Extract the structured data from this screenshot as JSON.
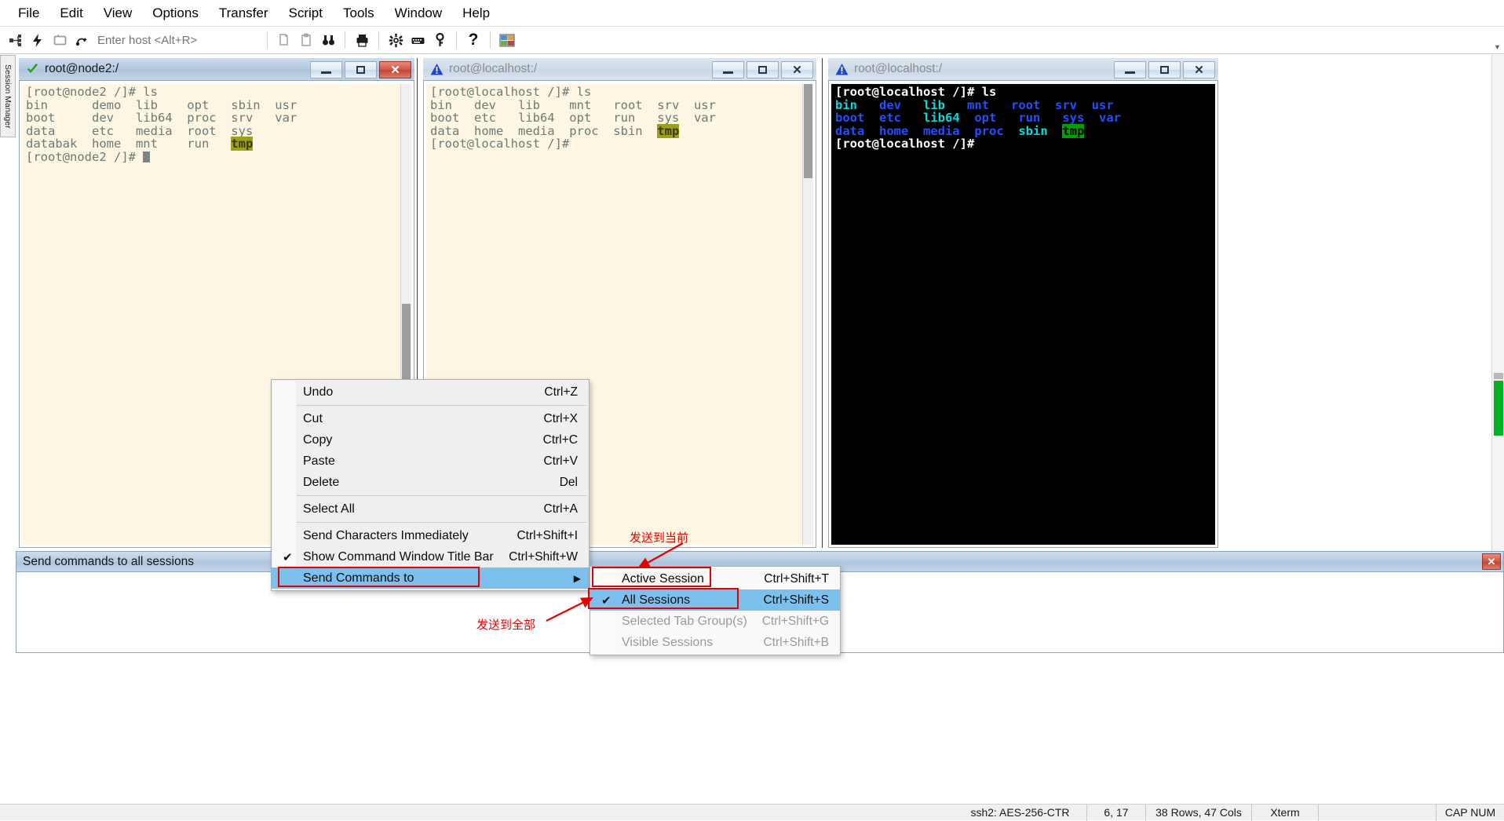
{
  "app": {
    "menubar": [
      "File",
      "Edit",
      "View",
      "Options",
      "Transfer",
      "Script",
      "Tools",
      "Window",
      "Help"
    ],
    "session_manager_label": "Session Manager"
  },
  "toolbar": {
    "host_placeholder": "Enter host <Alt+R>",
    "host_value": "",
    "buttons": [
      {
        "name": "connect-icon",
        "glyph": "⊷"
      },
      {
        "name": "quick-connect-icon",
        "glyph": "⚡"
      },
      {
        "name": "reconnect-icon",
        "glyph": "⟲"
      },
      {
        "name": "reconnect-all-icon",
        "glyph": "↝"
      },
      {
        "name": "copy-icon",
        "glyph": "❐"
      },
      {
        "name": "paste-icon",
        "glyph": "❏"
      },
      {
        "name": "find-icon",
        "glyph": "👓"
      },
      {
        "name": "print-icon",
        "glyph": "🖶"
      },
      {
        "name": "session-options-icon",
        "glyph": "✿"
      },
      {
        "name": "keymap-editor-icon",
        "glyph": "⌨"
      },
      {
        "name": "key-icon",
        "glyph": "⚷"
      },
      {
        "name": "help-icon",
        "glyph": "?"
      },
      {
        "name": "tile-windows-icon",
        "glyph": "▦"
      }
    ],
    "overflow_glyph": "▾"
  },
  "panes": [
    {
      "title": "root@node2:/",
      "status_icon": "check-icon",
      "active": true,
      "theme": "light",
      "lines": [
        [
          {
            "t": "[root@node2 /]# ls",
            "c": "fg"
          }
        ],
        [
          {
            "t": "bin      demo  lib    opt   sbin  usr",
            "c": "fg"
          }
        ],
        [
          {
            "t": "boot     dev   lib64  proc  srv   var",
            "c": "fg"
          }
        ],
        [
          {
            "t": "data     etc   media  root  sys",
            "c": "fg"
          }
        ],
        [
          {
            "t": "databak  home  mnt    run   ",
            "c": "fg"
          },
          {
            "t": "tmp",
            "c": "tmp"
          }
        ],
        [
          {
            "t": "[root@node2 /]# ",
            "c": "fg"
          }
        ]
      ]
    },
    {
      "title": "root@localhost:/",
      "status_icon": "warning-icon",
      "active": false,
      "theme": "light",
      "lines": [
        [
          {
            "t": "[root@localhost /]# ls",
            "c": "fg"
          }
        ],
        [
          {
            "t": "bin   dev   lib    mnt   root  srv  usr",
            "c": "fg"
          }
        ],
        [
          {
            "t": "boot  etc   lib64  opt   run   sys  var",
            "c": "fg"
          }
        ],
        [
          {
            "t": "data  home  media  proc  sbin  ",
            "c": "fg"
          },
          {
            "t": "tmp",
            "c": "tmp"
          }
        ],
        [
          {
            "t": "[root@localhost /]# ",
            "c": "fg"
          }
        ]
      ]
    },
    {
      "title": "root@localhost:/",
      "status_icon": "warning-icon",
      "active": false,
      "theme": "dark",
      "lines": [
        [
          {
            "t": "[root@localhost /]# ls",
            "c": "prompt"
          }
        ],
        [
          {
            "t": "bin   ",
            "c": "lnk"
          },
          {
            "t": "dev   ",
            "c": "dir"
          },
          {
            "t": "lib   ",
            "c": "lnk"
          },
          {
            "t": "mnt   ",
            "c": "dir"
          },
          {
            "t": "root  ",
            "c": "dir"
          },
          {
            "t": "srv  ",
            "c": "dir"
          },
          {
            "t": "usr",
            "c": "dir"
          }
        ],
        [
          {
            "t": "boot  ",
            "c": "dir"
          },
          {
            "t": "etc   ",
            "c": "dir"
          },
          {
            "t": "lib64  ",
            "c": "lnk"
          },
          {
            "t": "opt   ",
            "c": "dir"
          },
          {
            "t": "run   ",
            "c": "dir"
          },
          {
            "t": "sys  ",
            "c": "dir"
          },
          {
            "t": "var",
            "c": "dir"
          }
        ],
        [
          {
            "t": "data  ",
            "c": "dir"
          },
          {
            "t": "home  ",
            "c": "dir"
          },
          {
            "t": "media  ",
            "c": "dir"
          },
          {
            "t": "proc  ",
            "c": "dir"
          },
          {
            "t": "sbin  ",
            "c": "lnk"
          },
          {
            "t": "tmp",
            "c": "tmp"
          }
        ],
        [
          {
            "t": "[root@localhost /]# ",
            "c": "prompt"
          }
        ]
      ]
    }
  ],
  "window_controls": {
    "minimize": "–",
    "maximize": "❐",
    "close": "✕"
  },
  "command_window": {
    "title": "Send commands to all sessions",
    "close_label": "✕",
    "content": ""
  },
  "context_menu": {
    "items": [
      {
        "label": "Undo",
        "accel": "Ctrl+Z",
        "checked": false,
        "disabled": false,
        "submenu": false
      },
      {
        "sep": true
      },
      {
        "label": "Cut",
        "accel": "Ctrl+X",
        "checked": false,
        "disabled": false,
        "submenu": false
      },
      {
        "label": "Copy",
        "accel": "Ctrl+C",
        "checked": false,
        "disabled": false,
        "submenu": false
      },
      {
        "label": "Paste",
        "accel": "Ctrl+V",
        "checked": false,
        "disabled": false,
        "submenu": false
      },
      {
        "label": "Delete",
        "accel": "Del",
        "checked": false,
        "disabled": false,
        "submenu": false
      },
      {
        "sep": true
      },
      {
        "label": "Select All",
        "accel": "Ctrl+A",
        "checked": false,
        "disabled": false,
        "submenu": false
      },
      {
        "sep": true
      },
      {
        "label": "Send Characters Immediately",
        "accel": "Ctrl+Shift+I",
        "checked": false,
        "disabled": false,
        "submenu": false
      },
      {
        "label": "Show Command Window Title Bar",
        "accel": "Ctrl+Shift+W",
        "checked": true,
        "disabled": false,
        "submenu": false
      },
      {
        "label": "Send Commands to",
        "accel": "",
        "checked": false,
        "disabled": false,
        "submenu": true,
        "highlighted": true
      }
    ]
  },
  "submenu": {
    "items": [
      {
        "label": "Active Session",
        "accel": "Ctrl+Shift+T",
        "checked": false,
        "disabled": false,
        "highlighted": false
      },
      {
        "label": "All Sessions",
        "accel": "Ctrl+Shift+S",
        "checked": true,
        "disabled": false,
        "highlighted": true
      },
      {
        "label": "Selected Tab Group(s)",
        "accel": "Ctrl+Shift+G",
        "checked": false,
        "disabled": true,
        "highlighted": false
      },
      {
        "label": "Visible Sessions",
        "accel": "Ctrl+Shift+B",
        "checked": false,
        "disabled": true,
        "highlighted": false
      }
    ]
  },
  "annotations": [
    {
      "text": "发送到当前",
      "target": "Active Session"
    },
    {
      "text": "发送到全部",
      "target": "All Sessions"
    }
  ],
  "statusbar": {
    "cells": [
      "",
      "ssh2: AES-256-CTR",
      "6, 17",
      "38 Rows, 47 Cols",
      "Xterm",
      "",
      "CAP NUM"
    ]
  },
  "colors": {
    "accent_blue": "#7cc1ee",
    "annotation_red": "#e80000",
    "title_active": "#b6cae0",
    "terminal_light_bg": "#fdf6e3",
    "terminal_dark_bg": "#000000",
    "tmp_highlight": "#9aa11a",
    "ok_green": "#06b025"
  }
}
